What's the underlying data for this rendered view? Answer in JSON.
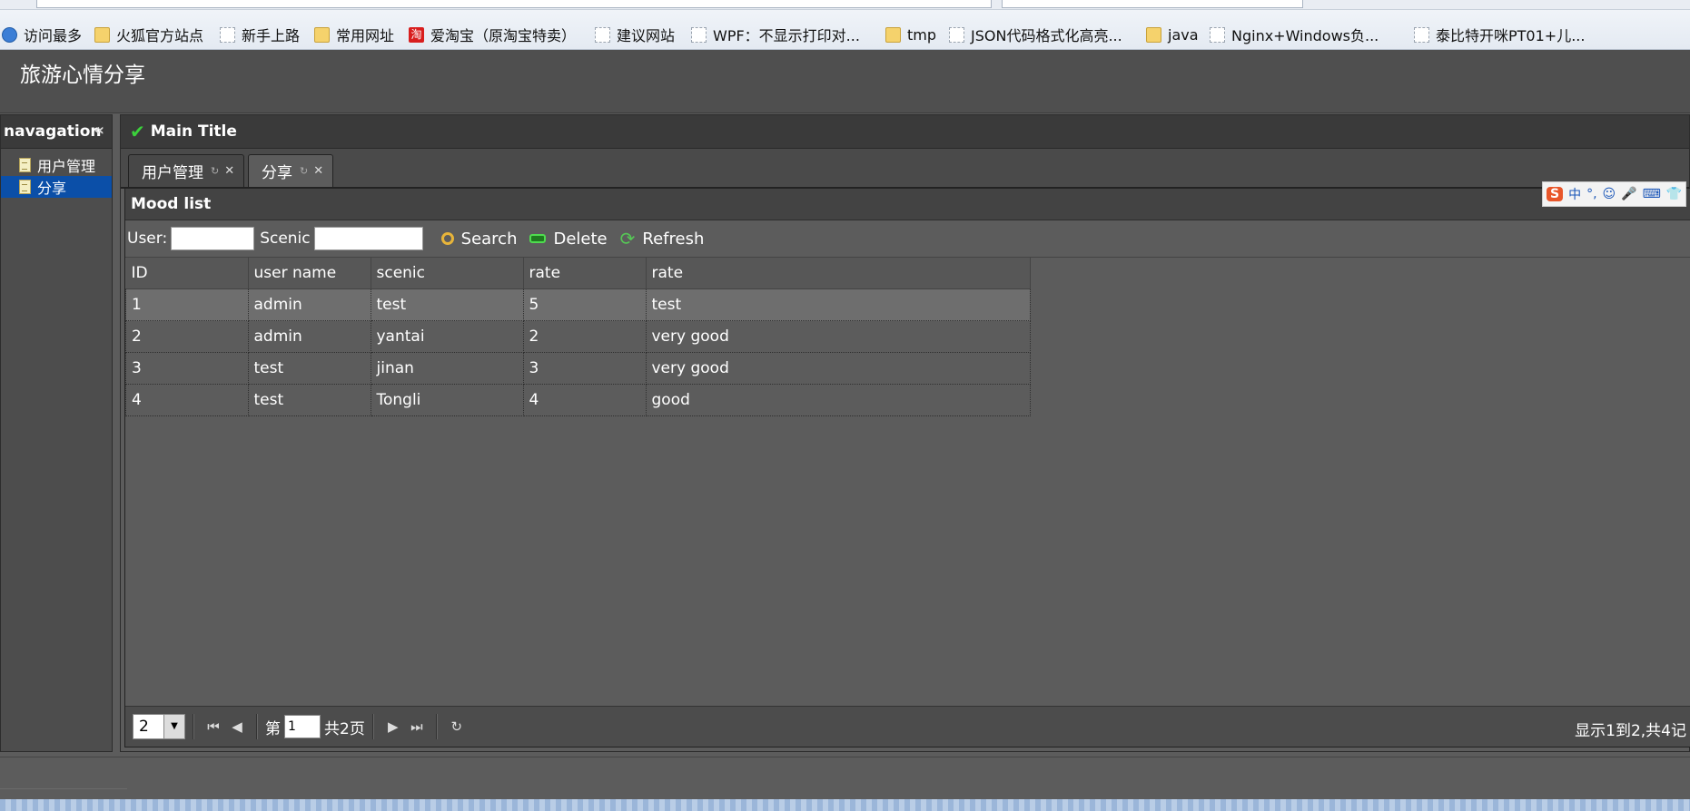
{
  "bookmarks": [
    {
      "label": "访问最多",
      "icon": "globe-icon"
    },
    {
      "label": "火狐官方站点",
      "icon": "folder-icon"
    },
    {
      "label": "新手上路",
      "icon": "page-icon"
    },
    {
      "label": "常用网址",
      "icon": "folder-icon"
    },
    {
      "label": "爱淘宝（原淘宝特卖）",
      "icon": "taobao-icon"
    },
    {
      "label": "建议网站",
      "icon": "page-icon"
    },
    {
      "label": "WPF：不显示打印对...",
      "icon": "page-icon"
    },
    {
      "label": "tmp",
      "icon": "folder-icon"
    },
    {
      "label": "JSON代码格式化高亮...",
      "icon": "page-icon"
    },
    {
      "label": "java",
      "icon": "folder-icon"
    },
    {
      "label": "Nginx+Windows负...",
      "icon": "page-icon"
    },
    {
      "label": "泰比特开咪PT01+儿...",
      "icon": "page-icon"
    }
  ],
  "header": {
    "title": "旅游心情分享"
  },
  "nav": {
    "title": "navagation",
    "collapse_glyph": "«",
    "items": [
      {
        "label": "用户管理"
      },
      {
        "label": "分享"
      }
    ]
  },
  "main": {
    "title": "Main Title",
    "tabs": [
      {
        "label": "用户管理"
      },
      {
        "label": "分享"
      }
    ]
  },
  "panel": {
    "title": "Mood list",
    "toolbar": {
      "user_label": "User:",
      "scenic_label": "Scenic",
      "user_value": "",
      "scenic_value": "",
      "search_label": "Search",
      "delete_label": "Delete",
      "refresh_label": "Refresh"
    },
    "columns": [
      "ID",
      "user name",
      "scenic",
      "rate",
      "rate"
    ],
    "rows": [
      [
        "1",
        "admin",
        "test",
        "5",
        "test"
      ],
      [
        "2",
        "admin",
        "yantai",
        "2",
        "very good"
      ],
      [
        "3",
        "test",
        "jinan",
        "3",
        "very good"
      ],
      [
        "4",
        "test",
        "Tongli",
        "4",
        "good"
      ]
    ]
  },
  "pager": {
    "page_size": "2",
    "page_prefix": "第",
    "current_page": "1",
    "total_pages": "共2页",
    "info": "显示1到2,共4记"
  },
  "ime": {
    "items": [
      "S",
      "中",
      "°,",
      "☺",
      "🎤",
      "⌨",
      "👕"
    ]
  },
  "colors": {
    "selected_nav": "#0b4fa8",
    "check": "#3bd13b",
    "background": "#5c5c5c"
  }
}
